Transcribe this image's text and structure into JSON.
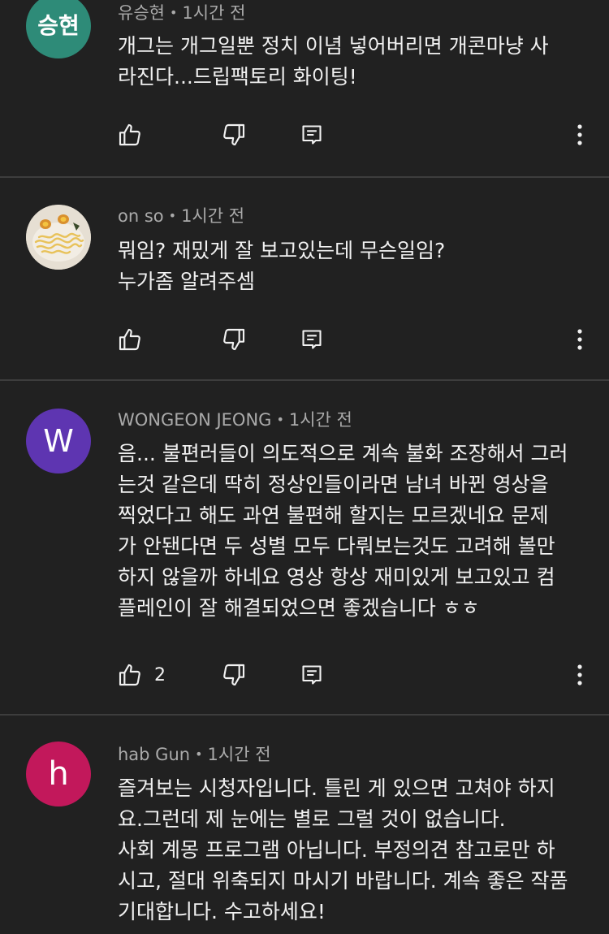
{
  "comments": [
    {
      "author": "유승현",
      "time": "1시간 전",
      "avatar_text": "승현",
      "avatar_color": "#2e8b78",
      "lines": [
        "개그는 개그일뿐 정치 이념 넣어버리면 개콘마냥 사",
        "라진다...드립팩토리 화이팅!"
      ],
      "likes": ""
    },
    {
      "author": "on so",
      "time": "1시간 전",
      "avatar_text": "",
      "avatar_color": "#d9d2c4",
      "avatar_photo": "noodle-bowl-photo",
      "lines": [
        "뭐임? 재밌게 잘 보고있는데 무슨일임?",
        "누가좀 알려주셈"
      ],
      "likes": ""
    },
    {
      "author": "WONGEON JEONG",
      "time": "1시간 전",
      "avatar_text": "W",
      "avatar_color": "#5e35b1",
      "lines": [
        "음... 불편러들이 의도적으로 계속 불화 조장해서 그러",
        "는것 같은데 딱히 정상인들이라면 남녀 바뀐 영상을",
        "찍었다고 해도 과연 불편해 할지는 모르겠네요 문제",
        "가 안됀다면 두 성별 모두 다뤄보는것도 고려해 볼만",
        "하지 않을까 하네요 영상 항상 재미있게 보고있고 컴",
        "플레인이 잘 해결되었으면 좋겠습니다 ㅎㅎ"
      ],
      "likes": "2"
    },
    {
      "author": "hab Gun",
      "time": "1시간 전",
      "avatar_text": "h",
      "avatar_color": "#c2185b",
      "lines": [
        "즐겨보는 시청자입니다. 틀린 게 있으면 고쳐야 하지",
        "요.그런데 제 눈에는 별로 그럴 것이 없습니다.",
        "사회 계몽 프로그램 아닙니다. 부정의견 참고로만 하",
        "시고, 절대 위축되지 마시기 바랍니다. 계속 좋은 작품",
        "기대합니다. 수고하세요!"
      ],
      "likes": ""
    }
  ],
  "meta_separator": "•",
  "icons": {
    "like": "thumbs-up-icon",
    "dislike": "thumbs-down-icon",
    "reply": "reply-icon",
    "more": "more-vert-icon"
  }
}
